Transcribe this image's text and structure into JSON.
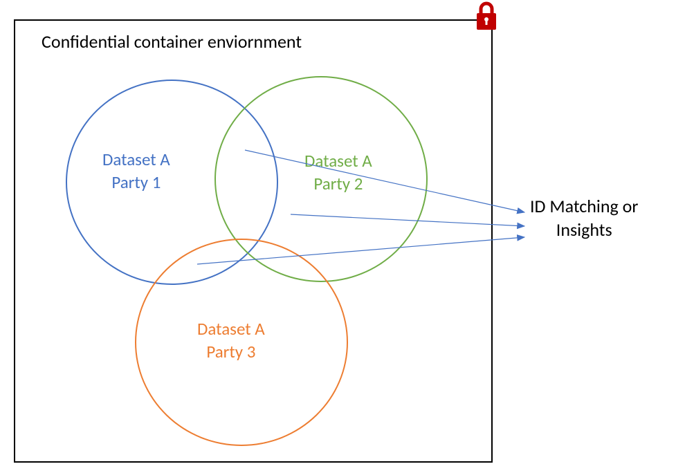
{
  "container": {
    "title": "Confidential container enviornment"
  },
  "circles": {
    "circle1": {
      "line1": "Dataset A",
      "line2": "Party 1"
    },
    "circle2": {
      "line1": "Dataset A",
      "line2": "Party 2"
    },
    "circle3": {
      "line1": "Dataset A",
      "line2": "Party 3"
    }
  },
  "output": {
    "line1": "ID Matching or",
    "line2": "Insights"
  },
  "colors": {
    "blue": "#4472C4",
    "green": "#70AD47",
    "orange": "#ED7D31",
    "lockRed": "#C00000"
  }
}
